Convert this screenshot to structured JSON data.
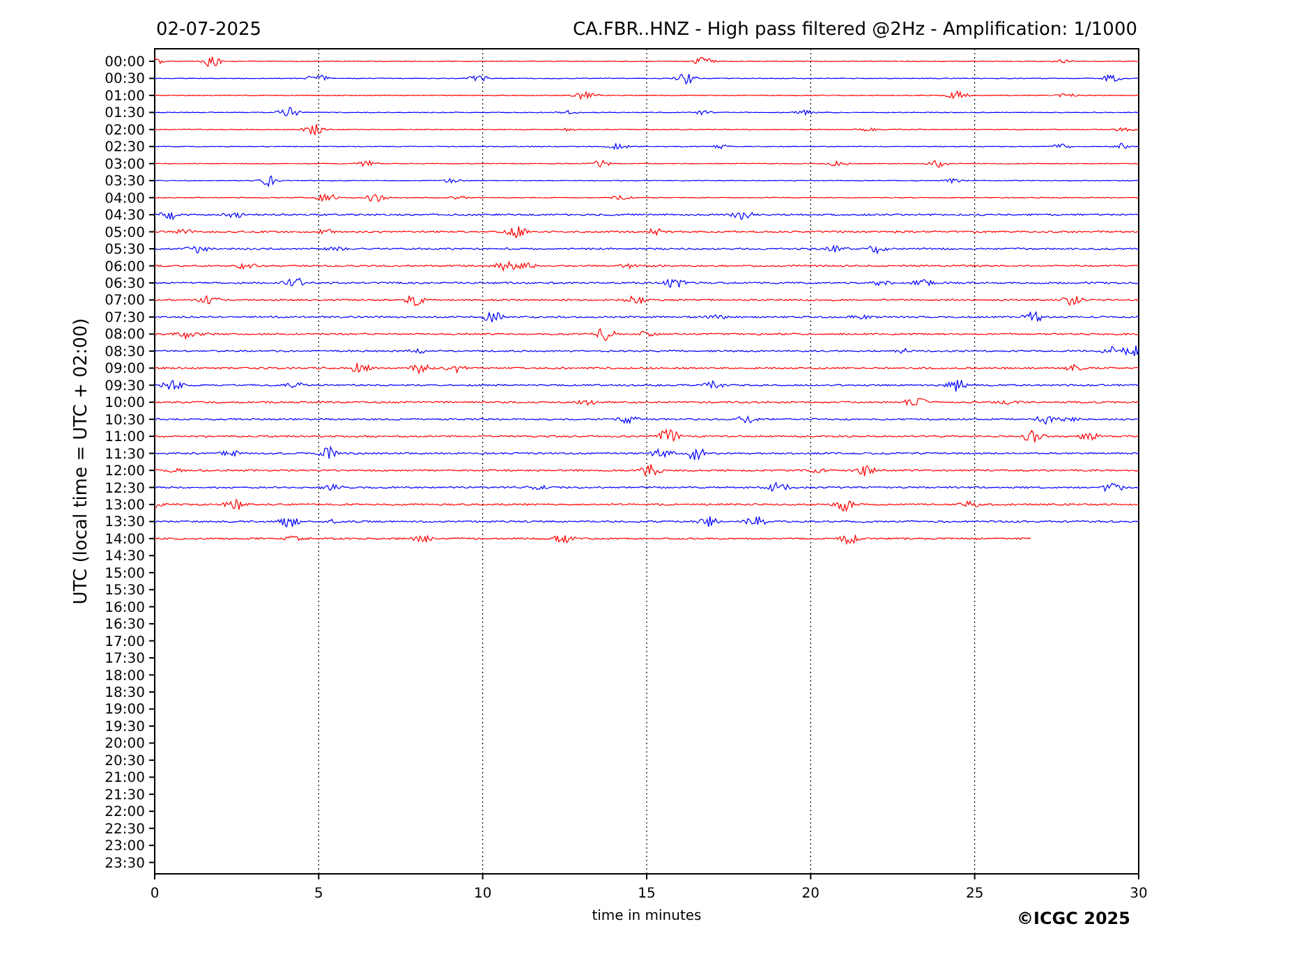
{
  "date": "02-07-2025",
  "title": "CA.FBR..HNZ - High pass filtered @2Hz - Amplification: 1/1000",
  "ylabel": "UTC (local time = UTC + 02:00)",
  "xlabel": "time in minutes",
  "xticks": [
    "0",
    "5",
    "10",
    "15",
    "20",
    "25",
    "30"
  ],
  "credit": "©ICGC 2025",
  "rows": [
    {
      "label": "00:00",
      "color": "#ff0000",
      "level": 1
    },
    {
      "label": "00:30",
      "color": "#0000ff",
      "level": 1
    },
    {
      "label": "01:00",
      "color": "#ff0000",
      "level": 1
    },
    {
      "label": "01:30",
      "color": "#0000ff",
      "level": 1
    },
    {
      "label": "02:00",
      "color": "#ff0000",
      "level": 1
    },
    {
      "label": "02:30",
      "color": "#0000ff",
      "level": 1
    },
    {
      "label": "03:00",
      "color": "#ff0000",
      "level": 1
    },
    {
      "label": "03:30",
      "color": "#0000ff",
      "level": 1
    },
    {
      "label": "04:00",
      "color": "#ff0000",
      "level": 1
    },
    {
      "label": "04:30",
      "color": "#0000ff",
      "level": 1
    },
    {
      "label": "05:00",
      "color": "#ff0000",
      "level": 1
    },
    {
      "label": "05:30",
      "color": "#0000ff",
      "level": 1
    },
    {
      "label": "06:00",
      "color": "#ff0000",
      "level": 1
    },
    {
      "label": "06:30",
      "color": "#0000ff",
      "level": 1
    },
    {
      "label": "07:00",
      "color": "#ff0000",
      "level": 1
    },
    {
      "label": "07:30",
      "color": "#0000ff",
      "level": 1
    },
    {
      "label": "08:00",
      "color": "#ff0000",
      "level": 1
    },
    {
      "label": "08:30",
      "color": "#0000ff",
      "level": 1
    },
    {
      "label": "09:00",
      "color": "#ff0000",
      "level": 1
    },
    {
      "label": "09:30",
      "color": "#0000ff",
      "level": 1
    },
    {
      "label": "10:00",
      "color": "#ff0000",
      "level": 1
    },
    {
      "label": "10:30",
      "color": "#0000ff",
      "level": 1
    },
    {
      "label": "11:00",
      "color": "#ff0000",
      "level": 1
    },
    {
      "label": "11:30",
      "color": "#0000ff",
      "level": 1
    },
    {
      "label": "12:00",
      "color": "#ff0000",
      "level": 1
    },
    {
      "label": "12:30",
      "color": "#0000ff",
      "level": 1
    },
    {
      "label": "13:00",
      "color": "#ff0000",
      "level": 1
    },
    {
      "label": "13:30",
      "color": "#0000ff",
      "level": 1
    },
    {
      "label": "14:00",
      "color": "#ff0000",
      "level": 0.89
    },
    {
      "label": "14:30"
    },
    {
      "label": "15:00"
    },
    {
      "label": "15:30"
    },
    {
      "label": "16:00"
    },
    {
      "label": "16:30"
    },
    {
      "label": "17:00"
    },
    {
      "label": "17:30"
    },
    {
      "label": "18:00"
    },
    {
      "label": "18:30"
    },
    {
      "label": "19:00"
    },
    {
      "label": "19:30"
    },
    {
      "label": "20:00"
    },
    {
      "label": "20:30"
    },
    {
      "label": "21:00"
    },
    {
      "label": "21:30"
    },
    {
      "label": "22:00"
    },
    {
      "label": "22:30"
    },
    {
      "label": "23:00"
    },
    {
      "label": "23:30"
    }
  ]
}
